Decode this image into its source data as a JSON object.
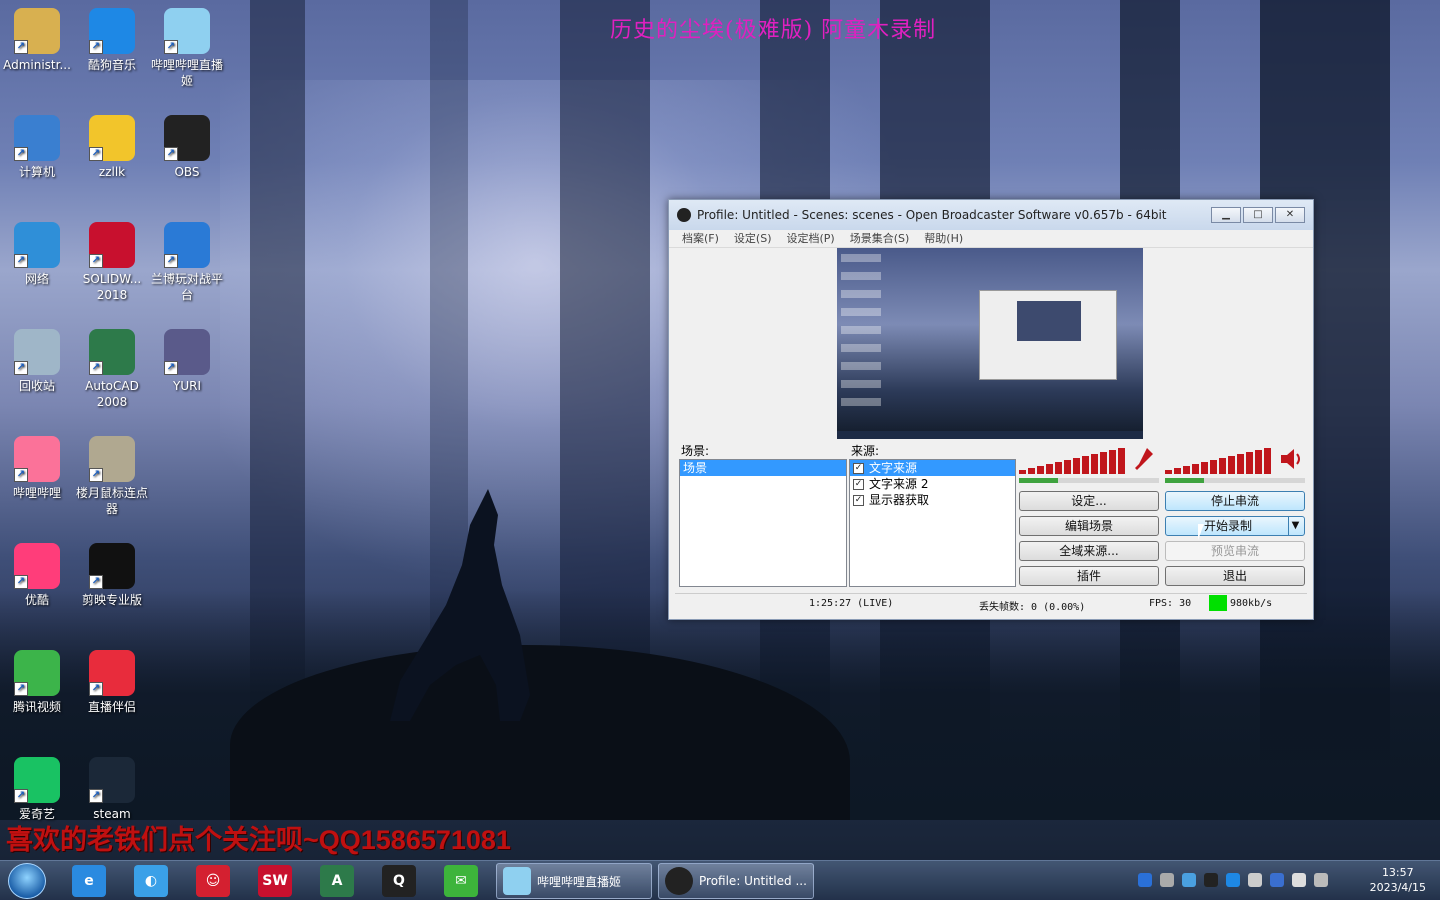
{
  "overlay": {
    "top_title": "历史的尘埃(极难版) 阿童木录制",
    "bottom_banner": "喜欢的老铁们点个关注呗~QQ1586571081"
  },
  "desktop_icons": [
    {
      "label": "Administr...",
      "icon": "user-folder-icon",
      "color": "#d8b050"
    },
    {
      "label": "酷狗音乐",
      "icon": "kugou-icon",
      "color": "#1e88e5"
    },
    {
      "label": "哔哩哔哩直播姬",
      "icon": "bilibili-live-icon",
      "color": "#8fd0f0"
    },
    {
      "label": "计算机",
      "icon": "computer-icon",
      "color": "#3a7fd0"
    },
    {
      "label": "zzllk",
      "icon": "pikachu-icon",
      "color": "#f2c52b"
    },
    {
      "label": "OBS",
      "icon": "obs-icon",
      "color": "#222222"
    },
    {
      "label": "网络",
      "icon": "network-icon",
      "color": "#2f8fd8"
    },
    {
      "label": "SOLIDW... 2018",
      "icon": "solidworks-icon",
      "color": "#c8102e"
    },
    {
      "label": "兰博玩对战平台",
      "icon": "lanbo-icon",
      "color": "#2a7ad6"
    },
    {
      "label": "回收站",
      "icon": "recycle-bin-icon",
      "color": "#9fb6c8"
    },
    {
      "label": "AutoCAD 2008",
      "icon": "autocad-icon",
      "color": "#2d7a4a"
    },
    {
      "label": "YURI",
      "icon": "yuri-icon",
      "color": "#5a5a8a"
    },
    {
      "label": "哔哩哔哩",
      "icon": "bilibili-icon",
      "color": "#fb7299"
    },
    {
      "label": "楼月鼠标连点器",
      "icon": "mouse-clicker-icon",
      "color": "#b0a890"
    },
    {
      "label": "",
      "icon": "blank-icon",
      "color": "transparent"
    },
    {
      "label": "优酷",
      "icon": "youku-icon",
      "color": "#ff3d7a"
    },
    {
      "label": "剪映专业版",
      "icon": "capcut-icon",
      "color": "#111111"
    },
    {
      "label": "",
      "icon": "blank-icon",
      "color": "transparent"
    },
    {
      "label": "腾讯视频",
      "icon": "tencent-video-icon",
      "color": "#3cb44a"
    },
    {
      "label": "直播伴侣",
      "icon": "live-companion-icon",
      "color": "#e82c3c"
    },
    {
      "label": "",
      "icon": "blank-icon",
      "color": "transparent"
    },
    {
      "label": "爱奇艺",
      "icon": "iqiyi-icon",
      "color": "#19c263"
    },
    {
      "label": "steam",
      "icon": "steam-icon",
      "color": "#1b2838"
    }
  ],
  "obs": {
    "title": "Profile: Untitled - Scenes: scenes - Open Broadcaster Software v0.657b - 64bit",
    "menu": [
      "档案(F)",
      "设定(S)",
      "设定档(P)",
      "场景集合(S)",
      "帮助(H)"
    ],
    "scenes_label": "场景:",
    "scenes": [
      "场景"
    ],
    "sources_label": "来源:",
    "sources": [
      {
        "name": "文字来源",
        "checked": true,
        "selected": true
      },
      {
        "name": "文字来源 2",
        "checked": true,
        "selected": false
      },
      {
        "name": "显示器获取",
        "checked": true,
        "selected": false
      }
    ],
    "buttons": {
      "settings": "设定...",
      "stop_stream": "停止串流",
      "edit_scene": "编辑场景",
      "start_record": "开始录制",
      "global_sources": "全域来源...",
      "preview_stream": "预览串流",
      "plugins": "插件",
      "exit": "退出"
    },
    "mic_level": 0.28,
    "desktop_level": 0.28,
    "status": {
      "time": "1:25:27 (LIVE)",
      "dropped": "丢失帧数: 0 (0.00%)",
      "fps": "FPS: 30",
      "bitrate": "980kb/s",
      "bitrate_color": "#00e000"
    }
  },
  "taskbar": {
    "pinned": [
      {
        "icon": "ie-icon",
        "color": "#2a8ae0",
        "text": "e"
      },
      {
        "icon": "browser-icon",
        "color": "#3aa0e8",
        "text": "◐"
      },
      {
        "icon": "app-red-icon",
        "color": "#d42030",
        "text": "☺"
      },
      {
        "icon": "solidworks-taskbar-icon",
        "color": "#c8102e",
        "text": "SW"
      },
      {
        "icon": "autocad-taskbar-icon",
        "color": "#2d7a4a",
        "text": "A"
      },
      {
        "icon": "qq-icon",
        "color": "#222222",
        "text": "Q"
      },
      {
        "icon": "wechat-icon",
        "color": "#3db43b",
        "text": "✉"
      }
    ],
    "tasks": [
      {
        "label": "哔哩哔哩直播姬",
        "icon": "bilibili-live-task-icon",
        "color": "#8fd0f0"
      },
      {
        "label": "Profile: Untitled ...",
        "icon": "obs-task-icon",
        "color": "#222222"
      }
    ],
    "time": "13:57",
    "date": "2023/4/15"
  }
}
